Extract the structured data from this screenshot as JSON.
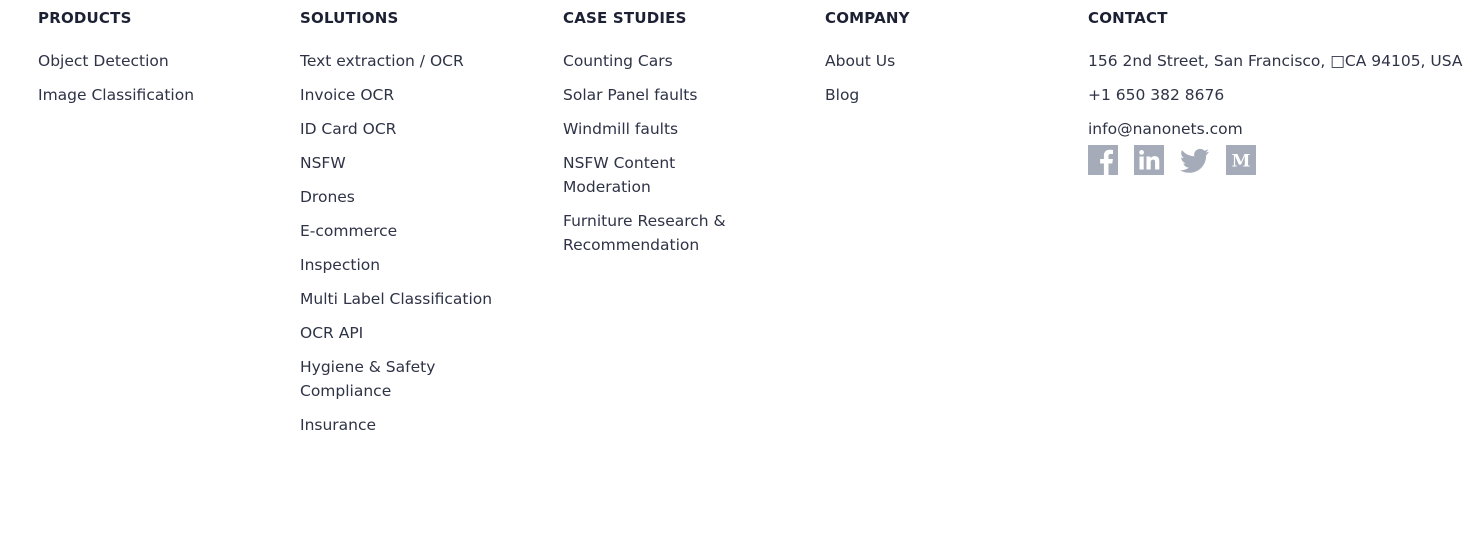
{
  "columns": {
    "products": {
      "heading": "PRODUCTS",
      "links": [
        "Object Detection",
        "Image Classification"
      ]
    },
    "solutions": {
      "heading": "SOLUTIONS",
      "links": [
        "Text extraction / OCR",
        "Invoice OCR",
        "ID Card OCR",
        "NSFW",
        "Drones",
        "E-commerce",
        "Inspection",
        "Multi Label Classification",
        "OCR API",
        "Hygiene & Safety Compliance",
        "Insurance"
      ]
    },
    "case_studies": {
      "heading": "CASE STUDIES",
      "links": [
        "Counting Cars",
        "Solar Panel faults",
        "Windmill faults",
        "NSFW Content Moderation",
        "Furniture Research & Recommendation"
      ]
    },
    "company": {
      "heading": "COMPANY",
      "links": [
        "About Us",
        "Blog"
      ]
    },
    "contact": {
      "heading": "CONTACT",
      "address": "156 2nd Street, San Francisco, □CA 94105, USA",
      "phone": "+1 650 382 8676",
      "email": "info@nanonets.com",
      "social": [
        {
          "name": "facebook-icon"
        },
        {
          "name": "linkedin-icon"
        },
        {
          "name": "twitter-icon"
        },
        {
          "name": "medium-icon"
        }
      ]
    }
  },
  "colors": {
    "text": "#2e3346",
    "heading": "#1c2033",
    "icon": "#a5abb8"
  }
}
